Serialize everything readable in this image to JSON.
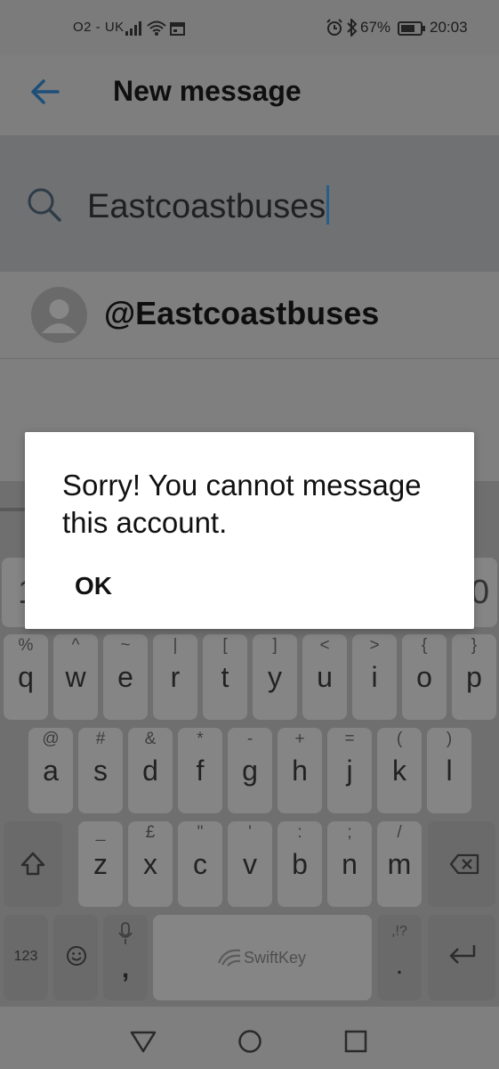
{
  "status_bar": {
    "carrier": "O2 - UK",
    "battery": "67%",
    "time": "20:03"
  },
  "header": {
    "title": "New message"
  },
  "search": {
    "query": "Eastcoastbuses"
  },
  "results": [
    {
      "handle": "@Eastcoastbuses"
    }
  ],
  "dialog": {
    "message": "Sorry! You cannot message this account.",
    "ok_label": "OK"
  },
  "keyboard": {
    "brand": "SwiftKey",
    "row1": [
      {
        "p": "q",
        "s": "%"
      },
      {
        "p": "w",
        "s": "^"
      },
      {
        "p": "e",
        "s": "~"
      },
      {
        "p": "r",
        "s": "|"
      },
      {
        "p": "t",
        "s": "["
      },
      {
        "p": "y",
        "s": "]"
      },
      {
        "p": "u",
        "s": "<"
      },
      {
        "p": "i",
        "s": ">"
      },
      {
        "p": "o",
        "s": "{"
      },
      {
        "p": "p",
        "s": "}"
      }
    ],
    "row2": [
      {
        "p": "a",
        "s": "@"
      },
      {
        "p": "s",
        "s": "#"
      },
      {
        "p": "d",
        "s": "&"
      },
      {
        "p": "f",
        "s": "*"
      },
      {
        "p": "g",
        "s": "-"
      },
      {
        "p": "h",
        "s": "+"
      },
      {
        "p": "j",
        "s": "="
      },
      {
        "p": "k",
        "s": "("
      },
      {
        "p": "l",
        "s": ")"
      }
    ],
    "row3": [
      {
        "p": "z",
        "s": "_"
      },
      {
        "p": "x",
        "s": "£"
      },
      {
        "p": "c",
        "s": "\""
      },
      {
        "p": "v",
        "s": "'"
      },
      {
        "p": "b",
        "s": ":"
      },
      {
        "p": "n",
        "s": ";"
      },
      {
        "p": "m",
        "s": "/"
      }
    ],
    "num_label": "123",
    "comma": ",",
    "period": ".",
    "period_alt": ",!?",
    "partial_number_left": "1",
    "partial_number_right": "0"
  }
}
